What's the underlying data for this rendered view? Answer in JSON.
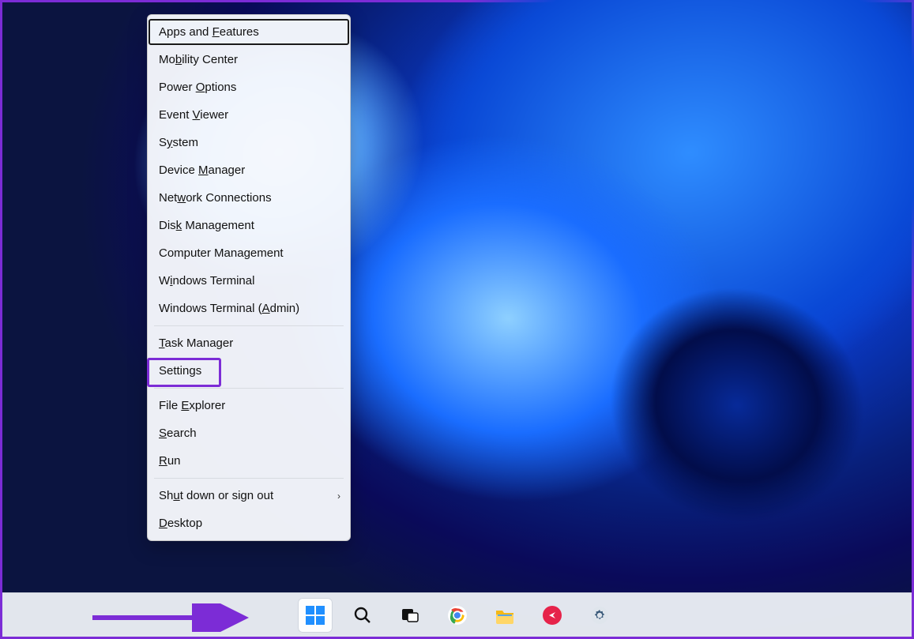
{
  "context_menu": {
    "groups": [
      [
        {
          "id": "apps-features",
          "before": "Apps and ",
          "u": "F",
          "after": "eatures"
        },
        {
          "id": "mobility-center",
          "before": "Mo",
          "u": "b",
          "after": "ility Center"
        },
        {
          "id": "power-options",
          "before": "Power ",
          "u": "O",
          "after": "ptions"
        },
        {
          "id": "event-viewer",
          "before": "Event ",
          "u": "V",
          "after": "iewer"
        },
        {
          "id": "system",
          "before": "S",
          "u": "y",
          "after": "stem"
        },
        {
          "id": "device-manager",
          "before": "Device ",
          "u": "M",
          "after": "anager"
        },
        {
          "id": "network-connections",
          "before": "Net",
          "u": "w",
          "after": "ork Connections"
        },
        {
          "id": "disk-management",
          "before": "Dis",
          "u": "k",
          "after": " Management"
        },
        {
          "id": "computer-management",
          "before": "Computer Mana",
          "u": "g",
          "after": "ement"
        },
        {
          "id": "windows-terminal",
          "before": "W",
          "u": "i",
          "after": "ndows Terminal"
        },
        {
          "id": "windows-terminal-admin",
          "before": "Windows Terminal (",
          "u": "A",
          "after": "dmin)"
        }
      ],
      [
        {
          "id": "task-manager",
          "before": "",
          "u": "T",
          "after": "ask Manager"
        },
        {
          "id": "settings",
          "before": "Settin",
          "u": "g",
          "after": "s"
        }
      ],
      [
        {
          "id": "file-explorer",
          "before": "File ",
          "u": "E",
          "after": "xplorer"
        },
        {
          "id": "search",
          "before": "",
          "u": "S",
          "after": "earch"
        },
        {
          "id": "run",
          "before": "",
          "u": "R",
          "after": "un"
        }
      ],
      [
        {
          "id": "shutdown-signout",
          "before": "Sh",
          "u": "u",
          "after": "t down or sign out",
          "submenu": true
        },
        {
          "id": "desktop",
          "before": "",
          "u": "D",
          "after": "esktop"
        }
      ]
    ],
    "highlighted_item_id": "settings"
  },
  "taskbar": {
    "items": [
      {
        "id": "start",
        "name": "start-button",
        "tooltip": "Start"
      },
      {
        "id": "search",
        "name": "search-button",
        "tooltip": "Search"
      },
      {
        "id": "taskview",
        "name": "task-view-button",
        "tooltip": "Task view"
      },
      {
        "id": "chrome",
        "name": "chrome-app",
        "tooltip": "Google Chrome"
      },
      {
        "id": "explorer",
        "name": "file-explorer-app",
        "tooltip": "File Explorer"
      },
      {
        "id": "getscreen",
        "name": "getscreen-app",
        "tooltip": "Getscreen"
      },
      {
        "id": "settings",
        "name": "settings-app",
        "tooltip": "Settings"
      }
    ]
  },
  "annotations": {
    "highlight_color": "#7c2cd6",
    "arrow_target": "start-button"
  }
}
